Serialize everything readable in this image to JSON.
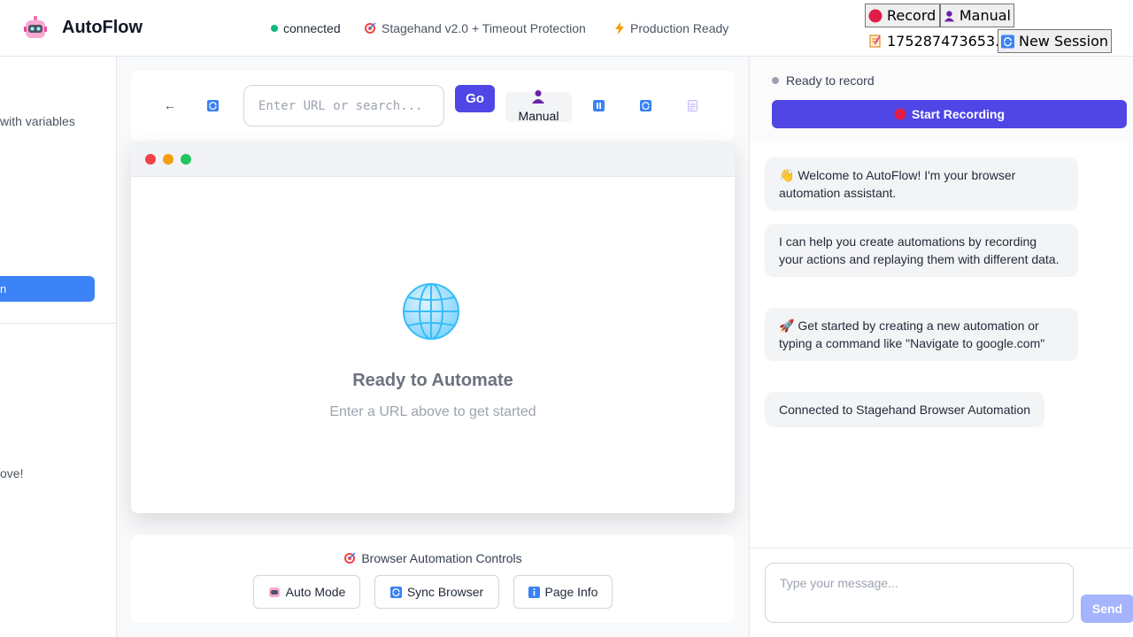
{
  "header": {
    "app_name": "AutoFlow",
    "status_connected": "connected",
    "status_stagehand": "Stagehand v2.0 + Timeout Protection",
    "status_production": "Production Ready",
    "record_label": "Record",
    "manual_label": "Manual",
    "session_id": "175287473653...",
    "new_session_label": "New Session"
  },
  "sidebar": {
    "fragment_variables": "with variables",
    "fragment_active": "n",
    "fragment_love": "ove!"
  },
  "toolbar": {
    "back_label": "←",
    "url_placeholder": "Enter URL or search...",
    "go_label": "Go",
    "manual_label": "Manual"
  },
  "browser": {
    "ready_title": "Ready to Automate",
    "ready_subtitle": "Enter a URL above to get started"
  },
  "controls": {
    "title": "Browser Automation Controls",
    "auto_mode_label": "Auto Mode",
    "sync_browser_label": "Sync Browser",
    "page_info_label": "Page Info"
  },
  "right_panel": {
    "record_status": "Ready to record",
    "start_recording_label": "Start Recording",
    "messages": [
      "👋 Welcome to AutoFlow! I'm your browser automation assistant.",
      "I can help you create automations by recording your actions and replaying them with different data.",
      "🚀 Get started by creating a new automation or typing a command like \"Navigate to google.com\"",
      "Connected to Stagehand Browser Automation"
    ],
    "message_placeholder": "Type your message...",
    "send_label": "Send"
  },
  "colors": {
    "accent": "#4f46e5",
    "sidebar_active": "#3b82f6",
    "connected_dot": "#10b981",
    "send_disabled": "#a5b4fc"
  }
}
